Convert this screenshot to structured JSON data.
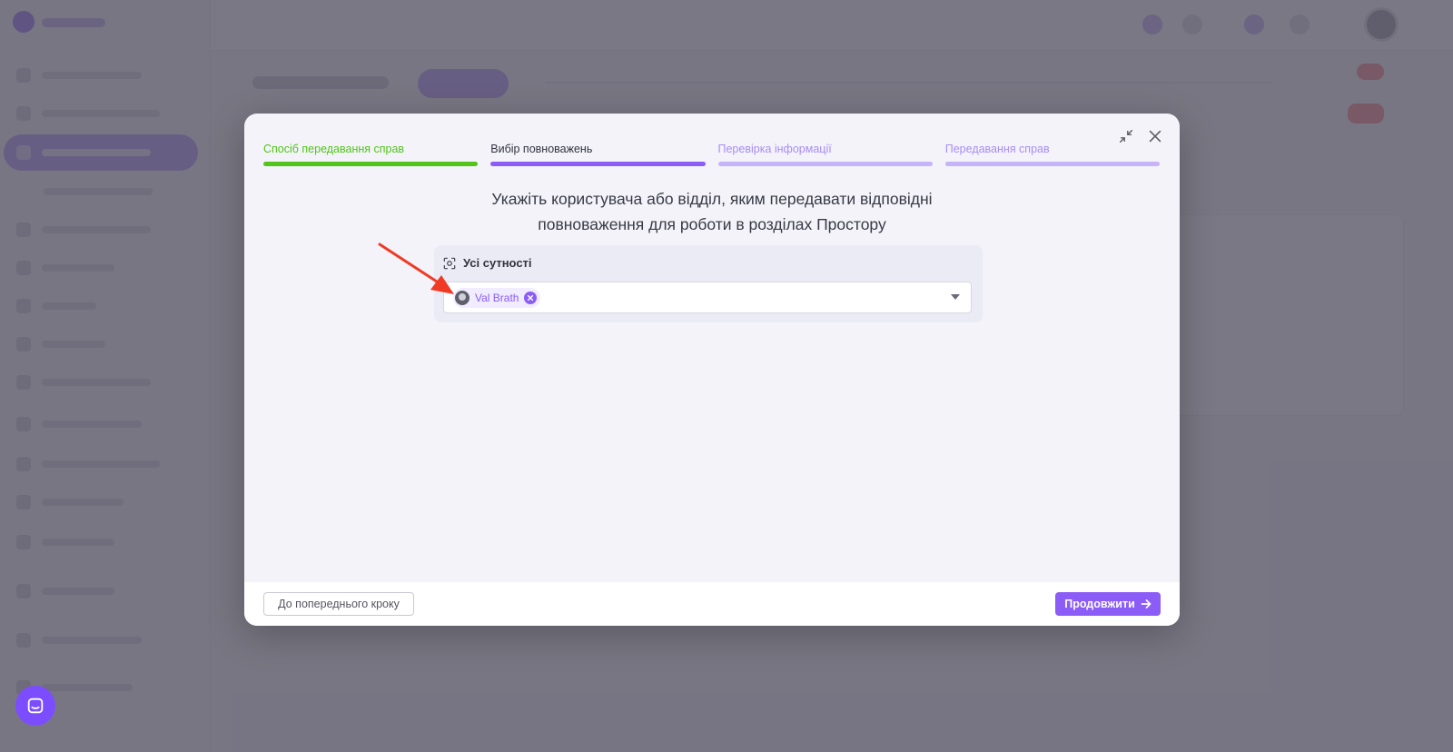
{
  "modal": {
    "steps": [
      {
        "label": "Спосіб передавання справ",
        "state": "done"
      },
      {
        "label": "Вибір повноважень",
        "state": "current"
      },
      {
        "label": "Перевірка інформації",
        "state": "todo"
      },
      {
        "label": "Передавання справ",
        "state": "todo"
      }
    ],
    "heading_line1": "Укажіть користувача або відділ, яким передавати відповідні",
    "heading_line2": "повноваження для роботи в розділах Простору",
    "panel": {
      "label": "Усі сутності",
      "selected_chip": "Val Brath"
    },
    "footer": {
      "back_label": "До попереднього кроку",
      "next_label": "Продовжити"
    }
  },
  "colors": {
    "accent": "#8b5cf6",
    "done": "#52c41a",
    "todo": "#c6b3f8",
    "annotation": "#f03a24"
  },
  "icons": {
    "minimize": "minimize-icon",
    "close": "close-icon",
    "entities": "entities-icon",
    "chip_remove": "remove-icon",
    "next_arrow": "arrow-right-icon",
    "chat": "chat-icon"
  }
}
